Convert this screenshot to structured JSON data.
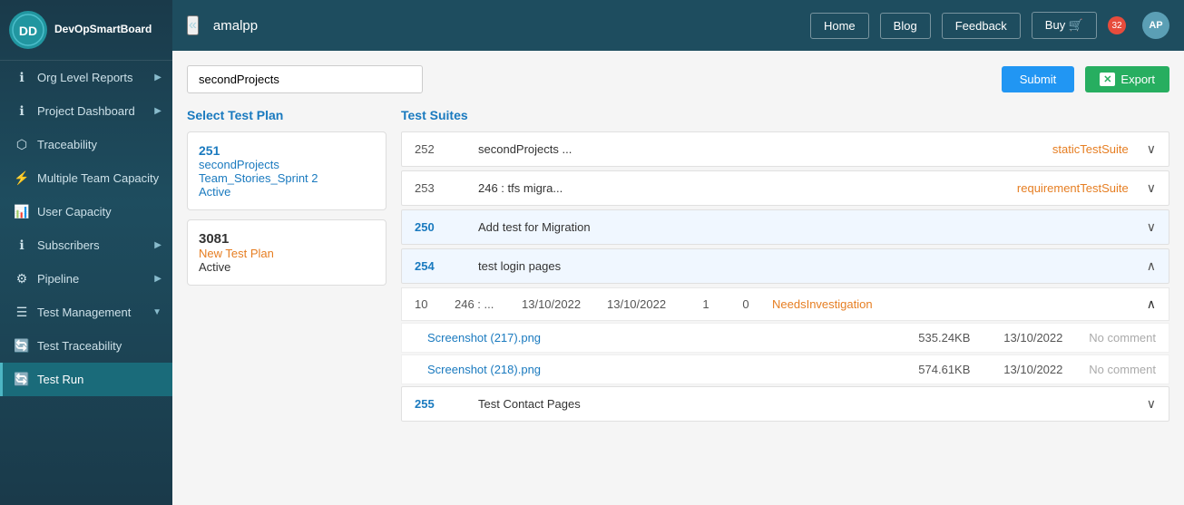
{
  "sidebar": {
    "logo": {
      "text": "DevOpSmartBoard",
      "icon": "DD"
    },
    "items": [
      {
        "id": "org-level-reports",
        "label": "Org Level Reports",
        "icon": "ℹ",
        "hasArrow": true,
        "active": false
      },
      {
        "id": "project-dashboard",
        "label": "Project Dashboard",
        "icon": "ℹ",
        "hasArrow": true,
        "active": false
      },
      {
        "id": "traceability",
        "label": "Traceability",
        "icon": "",
        "hasArrow": false,
        "active": false
      },
      {
        "id": "multiple-team-capacity",
        "label": "Multiple Team Capacity",
        "icon": "⚡",
        "hasArrow": false,
        "active": false
      },
      {
        "id": "user-capacity",
        "label": "User Capacity",
        "icon": "📊",
        "hasArrow": false,
        "active": false
      },
      {
        "id": "subscribers",
        "label": "Subscribers",
        "icon": "ℹ",
        "hasArrow": true,
        "active": false
      },
      {
        "id": "pipeline",
        "label": "Pipeline",
        "icon": "⚙",
        "hasArrow": true,
        "active": false
      },
      {
        "id": "test-management",
        "label": "Test Management",
        "icon": "",
        "hasArrow": true,
        "active": false
      },
      {
        "id": "test-traceability",
        "label": "Test Traceability",
        "icon": "🔄",
        "hasArrow": false,
        "active": false
      },
      {
        "id": "test-run",
        "label": "Test Run",
        "icon": "🔄",
        "hasArrow": false,
        "active": true
      }
    ]
  },
  "topbar": {
    "collapse_icon": "«",
    "title": "amalpp",
    "nav": [
      {
        "id": "home-btn",
        "label": "Home"
      },
      {
        "id": "blog-btn",
        "label": "Blog"
      },
      {
        "id": "feedback-btn",
        "label": "Feedback"
      },
      {
        "id": "buy-btn",
        "label": "Buy 🛒"
      }
    ],
    "avatar": "AP",
    "badge": "32"
  },
  "search": {
    "value": "secondProjects",
    "placeholder": "secondProjects",
    "submit_label": "Submit",
    "export_label": "Export",
    "export_icon": "✕"
  },
  "left_panel": {
    "title": "Select Test Plan",
    "plans": [
      {
        "id": "251",
        "name": "secondProjects",
        "sprint": "Team_Stories_Sprint 2",
        "status": "Active"
      },
      {
        "id": "3081",
        "name": "New Test Plan",
        "status": "Active"
      }
    ]
  },
  "right_panel": {
    "title": "Test Suites",
    "suites": [
      {
        "id": "252",
        "name": "secondProjects ...",
        "type": "staticTestSuite",
        "expanded": false
      },
      {
        "id": "253",
        "name": "246 : tfs migra...",
        "type": "requirementTestSuite",
        "expanded": false
      },
      {
        "id": "250",
        "name": "Add test for Migration",
        "type": "",
        "expanded": false,
        "highlight": true
      },
      {
        "id": "254",
        "name": "test login pages",
        "type": "",
        "expanded": true,
        "highlight": true,
        "sub_items": [
          {
            "num": "10",
            "id_ref": "246 : ...",
            "date1": "13/10/2022",
            "date2": "13/10/2022",
            "count1": "1",
            "count2": "0",
            "status": "NeedsInvestigation",
            "expanded": true,
            "attachments": [
              {
                "name": "Screenshot (217).png",
                "size": "535.24KB",
                "date": "13/10/2022",
                "comment": "No comment"
              },
              {
                "name": "Screenshot (218).png",
                "size": "574.61KB",
                "date": "13/10/2022",
                "comment": "No comment"
              }
            ]
          }
        ]
      },
      {
        "id": "255",
        "name": "Test Contact Pages",
        "type": "",
        "expanded": false,
        "partial": true
      }
    ]
  }
}
